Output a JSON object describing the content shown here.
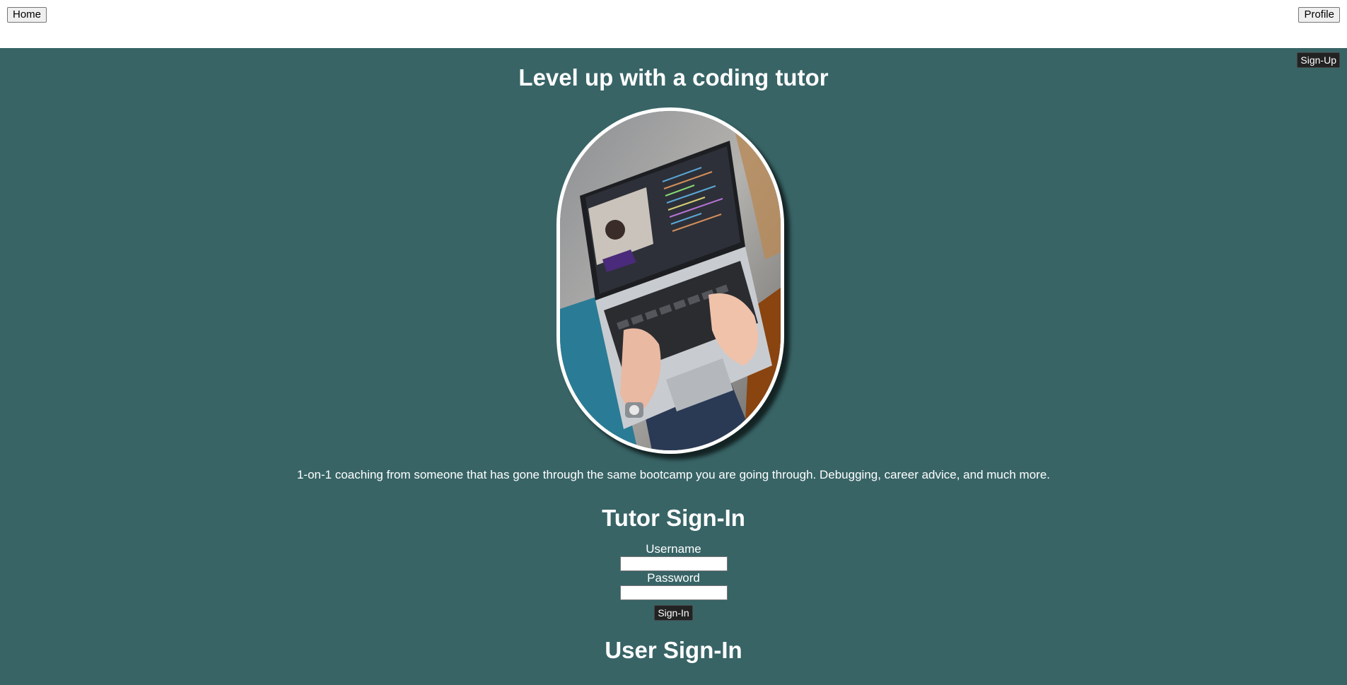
{
  "nav": {
    "home_label": "Home",
    "profile_label": "Profile"
  },
  "main": {
    "signup_label": "Sign-Up",
    "title": "Level up with a coding tutor",
    "description": "1-on-1 coaching from someone that has gone through the same bootcamp you are going through. Debugging, career advice, and much more.",
    "background_color": "#386466"
  },
  "tutor_signin": {
    "title": "Tutor Sign-In",
    "username_label": "Username",
    "username_value": "",
    "password_label": "Password",
    "password_value": "",
    "submit_label": "Sign-In"
  },
  "user_signin": {
    "title": "User Sign-In"
  }
}
